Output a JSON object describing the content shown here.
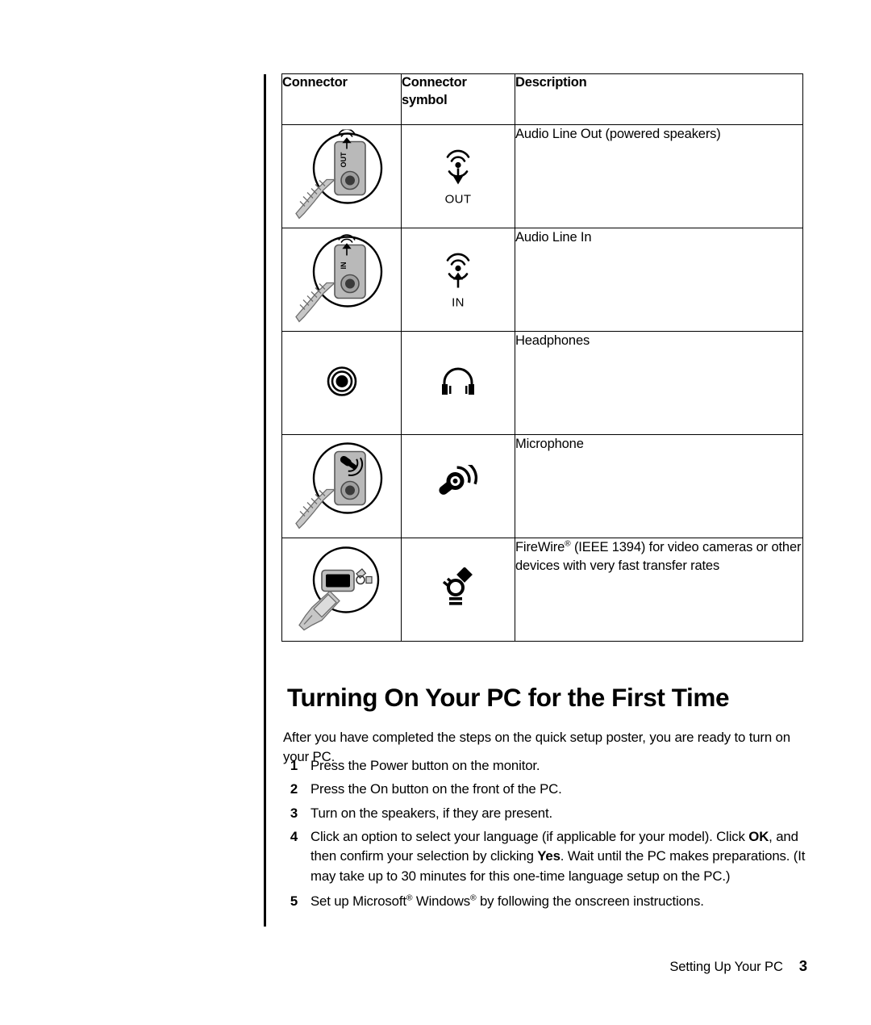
{
  "document": {
    "heading": "Turning On Your PC for the First Time",
    "intro": "After you have completed the steps on the quick setup poster, you are ready to turn on your PC."
  },
  "table": {
    "headers": {
      "connector": "Connector",
      "symbol_line1": "Connector",
      "symbol_line2": "symbol",
      "description": "Description"
    },
    "rows": [
      {
        "connector_icon": "audio-line-out-jack-illustration",
        "symbol_icon": "audio-line-out-symbol",
        "symbol_label": "OUT",
        "description": "Audio Line Out (powered speakers)"
      },
      {
        "connector_icon": "audio-line-in-jack-illustration",
        "symbol_icon": "audio-line-in-symbol",
        "symbol_label": "IN",
        "description": "Audio Line In"
      },
      {
        "connector_icon": "headphone-jack-illustration",
        "symbol_icon": "headphones-symbol",
        "symbol_label": "",
        "description": "Headphones"
      },
      {
        "connector_icon": "microphone-jack-illustration",
        "symbol_icon": "microphone-symbol",
        "symbol_label": "",
        "description": "Microphone"
      },
      {
        "connector_icon": "firewire-port-illustration",
        "symbol_icon": "firewire-symbol",
        "symbol_label": "",
        "description_html": "FireWire<sup>®</sup> (IEEE 1394) for video cameras or other devices with very fast transfer rates"
      }
    ]
  },
  "steps": [
    {
      "number": "1",
      "text": "Press the Power button on the monitor."
    },
    {
      "number": "2",
      "text": "Press the On button on the front of the PC."
    },
    {
      "number": "3",
      "text": "Turn on the speakers, if they are present."
    },
    {
      "number": "4",
      "text_html": "Click an option to select your language (if applicable for your model). Click <b>OK</b>, and then confirm your selection by clicking <b>Yes</b>. Wait until the PC makes preparations. (It may take up to 30 minutes for this one-time language setup on the PC.)"
    },
    {
      "number": "5",
      "text_html": "Set up Microsoft<sup>®</sup> Windows<sup>®</sup> by following the onscreen instructions."
    }
  ],
  "footer": {
    "section": "Setting Up Your PC",
    "page_number": "3"
  },
  "colors": {
    "text": "#000000",
    "rule": "#000000",
    "illustration_fill": "#b3b3b3",
    "illustration_dark": "#808080"
  }
}
